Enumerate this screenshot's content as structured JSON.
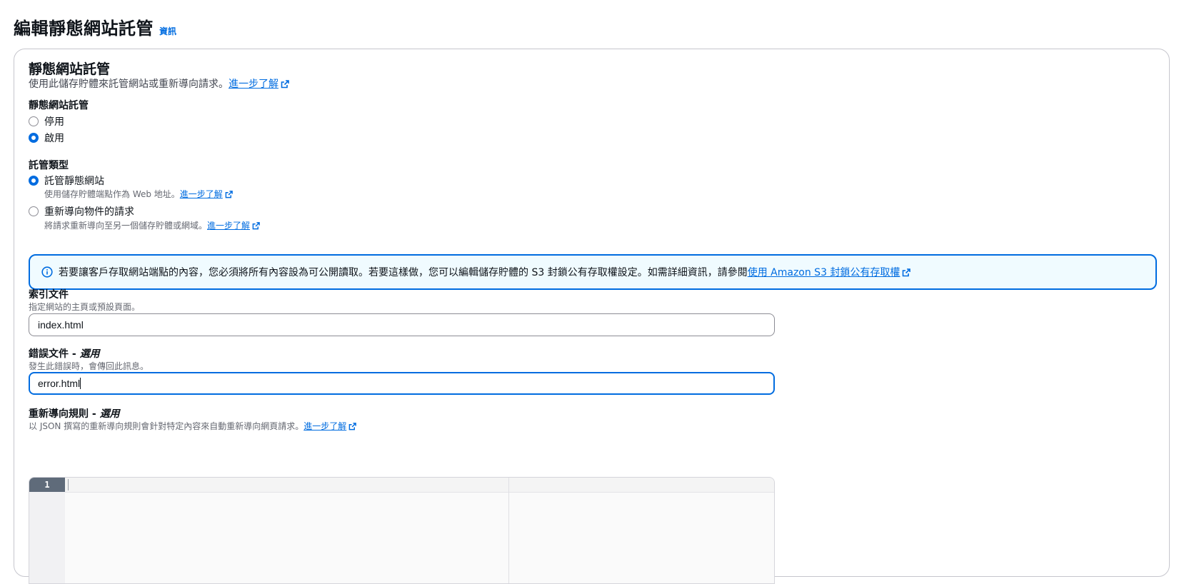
{
  "header": {
    "title": "編輯靜態網站託管",
    "info": "資訊"
  },
  "section": {
    "title": "靜態網站託管",
    "description": "使用此儲存貯體來託管網站或重新導向請求。",
    "learn_more": "進一步了解"
  },
  "hosting": {
    "label": "靜態網站託管",
    "options": [
      {
        "label": "停用",
        "checked": false
      },
      {
        "label": "啟用",
        "checked": true
      }
    ]
  },
  "hosting_type": {
    "label": "託管類型",
    "options": [
      {
        "label": "託管靜態網站",
        "description": "使用儲存貯體端點作為 Web 地址。",
        "learn_more": "進一步了解",
        "checked": true
      },
      {
        "label": "重新導向物件的請求",
        "description": "將請求重新導向至另一個儲存貯體或網域。",
        "learn_more": "進一步了解",
        "checked": false
      }
    ]
  },
  "alert": {
    "text": "若要讓客戶存取網站端點的內容，您必須將所有內容設為可公開讀取。若要這樣做，您可以編輯儲存貯體的 S3 封鎖公有存取權設定。如需詳細資訊，請參閱",
    "link": "使用 Amazon S3 封鎖公有存取權"
  },
  "index_document": {
    "label": "索引文件",
    "description": "指定網站的主頁或預設頁面。",
    "value": "index.html"
  },
  "error_document": {
    "label": "錯誤文件",
    "optional": "選用",
    "description": "發生此錯誤時，會傳回此訊息。",
    "value": "error.html"
  },
  "redirect_rules": {
    "label": "重新導向規則",
    "optional": "選用",
    "description": "以 JSON 撰寫的重新導向規則會針對特定內容來自動重新導向網頁請求。",
    "learn_more": "進一步了解",
    "line_number": "1"
  },
  "colors": {
    "accent": "#006ce0",
    "alert_bg": "#f0fbff"
  },
  "icons": [
    "external-link-icon",
    "info-circle-icon"
  ]
}
